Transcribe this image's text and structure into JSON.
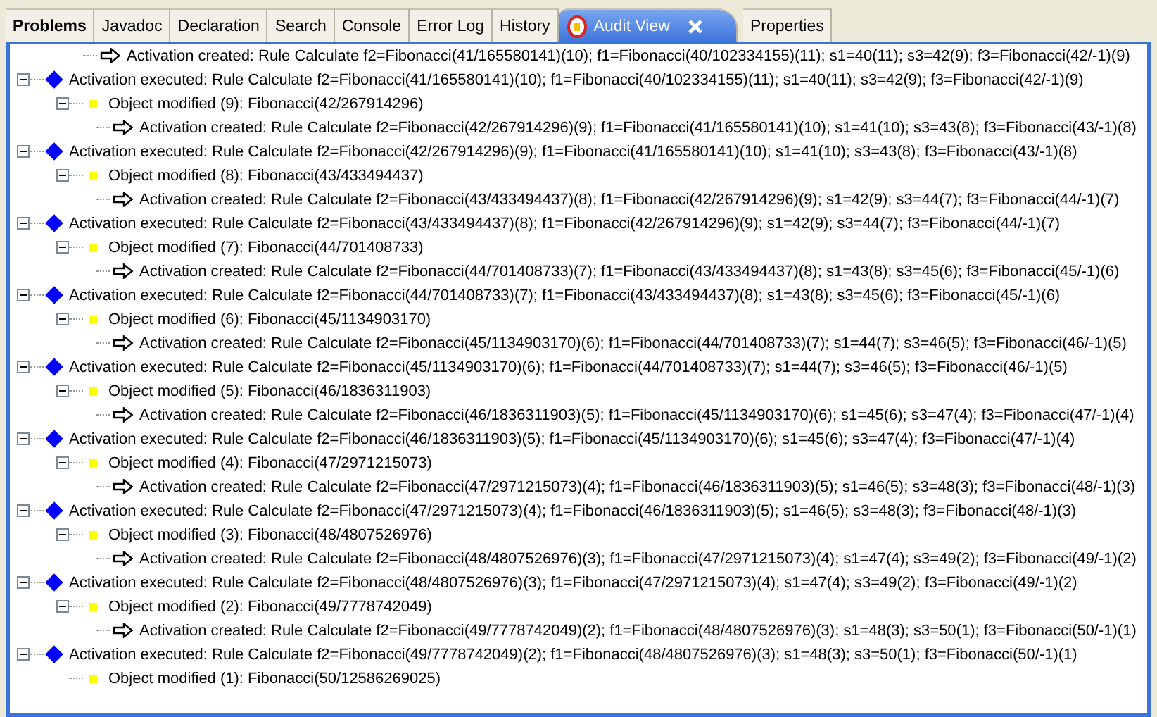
{
  "tabs": [
    {
      "label": "Problems",
      "selected": false,
      "bold": true
    },
    {
      "label": "Javadoc",
      "selected": false,
      "bold": false
    },
    {
      "label": "Declaration",
      "selected": false,
      "bold": false
    },
    {
      "label": "Search",
      "selected": false,
      "bold": false
    },
    {
      "label": "Console",
      "selected": false,
      "bold": false
    },
    {
      "label": "Error Log",
      "selected": false,
      "bold": false
    },
    {
      "label": "History",
      "selected": false,
      "bold": false
    },
    {
      "label": "Audit View",
      "selected": true,
      "bold": false,
      "closable": true
    },
    {
      "label": "Properties",
      "selected": false,
      "bold": false
    }
  ],
  "tree": [
    {
      "kind": "created",
      "text": "Activation created: Rule Calculate f2=Fibonacci(41/165580141)(10); f1=Fibonacci(40/102334155)(11); s1=40(11); s3=42(9); f3=Fibonacci(42/-1)(9)"
    },
    {
      "kind": "executed",
      "expanded": true,
      "text": "Activation executed: Rule Calculate f2=Fibonacci(41/165580141)(10); f1=Fibonacci(40/102334155)(11); s1=40(11); s3=42(9); f3=Fibonacci(42/-1)(9)",
      "children": [
        {
          "kind": "modified",
          "expanded": true,
          "text": "Object modified (9): Fibonacci(42/267914296)",
          "children": [
            {
              "kind": "created",
              "text": "Activation created: Rule Calculate f2=Fibonacci(42/267914296)(9); f1=Fibonacci(41/165580141)(10); s1=41(10); s3=43(8); f3=Fibonacci(43/-1)(8)"
            }
          ]
        }
      ]
    },
    {
      "kind": "executed",
      "expanded": true,
      "text": "Activation executed: Rule Calculate f2=Fibonacci(42/267914296)(9); f1=Fibonacci(41/165580141)(10); s1=41(10); s3=43(8); f3=Fibonacci(43/-1)(8)",
      "children": [
        {
          "kind": "modified",
          "expanded": true,
          "text": "Object modified (8): Fibonacci(43/433494437)",
          "children": [
            {
              "kind": "created",
              "text": "Activation created: Rule Calculate f2=Fibonacci(43/433494437)(8); f1=Fibonacci(42/267914296)(9); s1=42(9); s3=44(7); f3=Fibonacci(44/-1)(7)"
            }
          ]
        }
      ]
    },
    {
      "kind": "executed",
      "expanded": true,
      "text": "Activation executed: Rule Calculate f2=Fibonacci(43/433494437)(8); f1=Fibonacci(42/267914296)(9); s1=42(9); s3=44(7); f3=Fibonacci(44/-1)(7)",
      "children": [
        {
          "kind": "modified",
          "expanded": true,
          "text": "Object modified (7): Fibonacci(44/701408733)",
          "children": [
            {
              "kind": "created",
              "text": "Activation created: Rule Calculate f2=Fibonacci(44/701408733)(7); f1=Fibonacci(43/433494437)(8); s1=43(8); s3=45(6); f3=Fibonacci(45/-1)(6)"
            }
          ]
        }
      ]
    },
    {
      "kind": "executed",
      "expanded": true,
      "text": "Activation executed: Rule Calculate f2=Fibonacci(44/701408733)(7); f1=Fibonacci(43/433494437)(8); s1=43(8); s3=45(6); f3=Fibonacci(45/-1)(6)",
      "children": [
        {
          "kind": "modified",
          "expanded": true,
          "text": "Object modified (6): Fibonacci(45/1134903170)",
          "children": [
            {
              "kind": "created",
              "text": "Activation created: Rule Calculate f2=Fibonacci(45/1134903170)(6); f1=Fibonacci(44/701408733)(7); s1=44(7); s3=46(5); f3=Fibonacci(46/-1)(5)"
            }
          ]
        }
      ]
    },
    {
      "kind": "executed",
      "expanded": true,
      "text": "Activation executed: Rule Calculate f2=Fibonacci(45/1134903170)(6); f1=Fibonacci(44/701408733)(7); s1=44(7); s3=46(5); f3=Fibonacci(46/-1)(5)",
      "children": [
        {
          "kind": "modified",
          "expanded": true,
          "text": "Object modified (5): Fibonacci(46/1836311903)",
          "children": [
            {
              "kind": "created",
              "text": "Activation created: Rule Calculate f2=Fibonacci(46/1836311903)(5); f1=Fibonacci(45/1134903170)(6); s1=45(6); s3=47(4); f3=Fibonacci(47/-1)(4)"
            }
          ]
        }
      ]
    },
    {
      "kind": "executed",
      "expanded": true,
      "text": "Activation executed: Rule Calculate f2=Fibonacci(46/1836311903)(5); f1=Fibonacci(45/1134903170)(6); s1=45(6); s3=47(4); f3=Fibonacci(47/-1)(4)",
      "children": [
        {
          "kind": "modified",
          "expanded": true,
          "text": "Object modified (4): Fibonacci(47/2971215073)",
          "children": [
            {
              "kind": "created",
              "text": "Activation created: Rule Calculate f2=Fibonacci(47/2971215073)(4); f1=Fibonacci(46/1836311903)(5); s1=46(5); s3=48(3); f3=Fibonacci(48/-1)(3)"
            }
          ]
        }
      ]
    },
    {
      "kind": "executed",
      "expanded": true,
      "text": "Activation executed: Rule Calculate f2=Fibonacci(47/2971215073)(4); f1=Fibonacci(46/1836311903)(5); s1=46(5); s3=48(3); f3=Fibonacci(48/-1)(3)",
      "children": [
        {
          "kind": "modified",
          "expanded": true,
          "text": "Object modified (3): Fibonacci(48/4807526976)",
          "children": [
            {
              "kind": "created",
              "text": "Activation created: Rule Calculate f2=Fibonacci(48/4807526976)(3); f1=Fibonacci(47/2971215073)(4); s1=47(4); s3=49(2); f3=Fibonacci(49/-1)(2)"
            }
          ]
        }
      ]
    },
    {
      "kind": "executed",
      "expanded": true,
      "text": "Activation executed: Rule Calculate f2=Fibonacci(48/4807526976)(3); f1=Fibonacci(47/2971215073)(4); s1=47(4); s3=49(2); f3=Fibonacci(49/-1)(2)",
      "children": [
        {
          "kind": "modified",
          "expanded": true,
          "text": "Object modified (2): Fibonacci(49/7778742049)",
          "children": [
            {
              "kind": "created",
              "text": "Activation created: Rule Calculate f2=Fibonacci(49/7778742049)(2); f1=Fibonacci(48/4807526976)(3); s1=48(3); s3=50(1); f3=Fibonacci(50/-1)(1)"
            }
          ]
        }
      ]
    },
    {
      "kind": "executed",
      "expanded": true,
      "text": "Activation executed: Rule Calculate f2=Fibonacci(49/7778742049)(2); f1=Fibonacci(48/4807526976)(3); s1=48(3); s3=50(1); f3=Fibonacci(50/-1)(1)",
      "children": [
        {
          "kind": "modified",
          "text": "Object modified (1): Fibonacci(50/12586269025)"
        }
      ]
    }
  ]
}
